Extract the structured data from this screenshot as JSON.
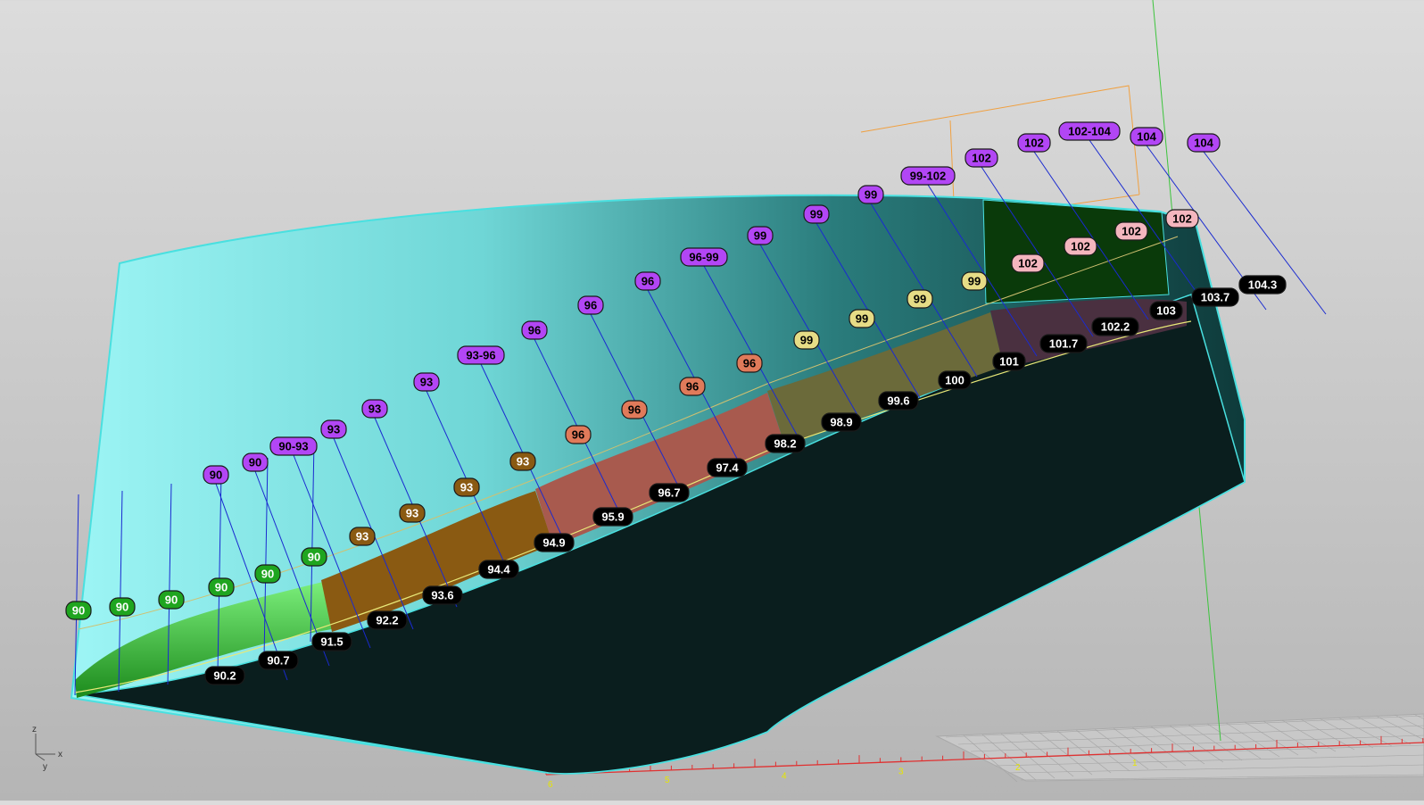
{
  "viewport": {
    "axes": {
      "z": "z",
      "x": "x",
      "y": "y"
    }
  },
  "ruler_ticks": [
    "6",
    "5",
    "4",
    "3",
    "2",
    "1"
  ],
  "colors": {
    "purple": "#a63df0",
    "green": "#1fa51f",
    "brown": "#8a5a12",
    "salmon": "#e07a5a",
    "khaki": "#e0d67a",
    "pink": "#f2b0b8",
    "black": "#000000"
  },
  "labels": [
    {
      "text": "90",
      "color": "green"
    },
    {
      "text": "90",
      "color": "green"
    },
    {
      "text": "90",
      "color": "green"
    },
    {
      "text": "90",
      "color": "green"
    },
    {
      "text": "90",
      "color": "green"
    },
    {
      "text": "90",
      "color": "green"
    },
    {
      "text": "90",
      "color": "purple"
    },
    {
      "text": "90",
      "color": "purple"
    },
    {
      "text": "90-93",
      "color": "purple"
    },
    {
      "text": "93",
      "color": "purple"
    },
    {
      "text": "93",
      "color": "purple"
    },
    {
      "text": "93",
      "color": "purple"
    },
    {
      "text": "93-96",
      "color": "purple"
    },
    {
      "text": "96",
      "color": "purple"
    },
    {
      "text": "96",
      "color": "purple"
    },
    {
      "text": "96",
      "color": "purple"
    },
    {
      "text": "96-99",
      "color": "purple"
    },
    {
      "text": "99",
      "color": "purple"
    },
    {
      "text": "99",
      "color": "purple"
    },
    {
      "text": "99",
      "color": "purple"
    },
    {
      "text": "99-102",
      "color": "purple"
    },
    {
      "text": "102",
      "color": "purple"
    },
    {
      "text": "102",
      "color": "purple"
    },
    {
      "text": "102-104",
      "color": "purple"
    },
    {
      "text": "104",
      "color": "purple"
    },
    {
      "text": "104",
      "color": "purple"
    },
    {
      "text": "93",
      "color": "brown"
    },
    {
      "text": "93",
      "color": "brown"
    },
    {
      "text": "93",
      "color": "brown"
    },
    {
      "text": "93",
      "color": "brown"
    },
    {
      "text": "96",
      "color": "salmon"
    },
    {
      "text": "96",
      "color": "salmon"
    },
    {
      "text": "96",
      "color": "salmon"
    },
    {
      "text": "96",
      "color": "salmon"
    },
    {
      "text": "99",
      "color": "khaki"
    },
    {
      "text": "99",
      "color": "khaki"
    },
    {
      "text": "99",
      "color": "khaki"
    },
    {
      "text": "99",
      "color": "khaki"
    },
    {
      "text": "102",
      "color": "pink"
    },
    {
      "text": "102",
      "color": "pink"
    },
    {
      "text": "102",
      "color": "pink"
    },
    {
      "text": "102",
      "color": "pink"
    },
    {
      "text": "90.2",
      "color": "black"
    },
    {
      "text": "90.7",
      "color": "black"
    },
    {
      "text": "91.5",
      "color": "black"
    },
    {
      "text": "92.2",
      "color": "black"
    },
    {
      "text": "93.6",
      "color": "black"
    },
    {
      "text": "94.4",
      "color": "black"
    },
    {
      "text": "94.9",
      "color": "black"
    },
    {
      "text": "95.9",
      "color": "black"
    },
    {
      "text": "96.7",
      "color": "black"
    },
    {
      "text": "97.4",
      "color": "black"
    },
    {
      "text": "98.2",
      "color": "black"
    },
    {
      "text": "98.9",
      "color": "black"
    },
    {
      "text": "99.6",
      "color": "black"
    },
    {
      "text": "100",
      "color": "black"
    },
    {
      "text": "101",
      "color": "black"
    },
    {
      "text": "101.7",
      "color": "black"
    },
    {
      "text": "102.2",
      "color": "black"
    },
    {
      "text": "103",
      "color": "black"
    },
    {
      "text": "103.7",
      "color": "black"
    },
    {
      "text": "104.3",
      "color": "black"
    }
  ]
}
